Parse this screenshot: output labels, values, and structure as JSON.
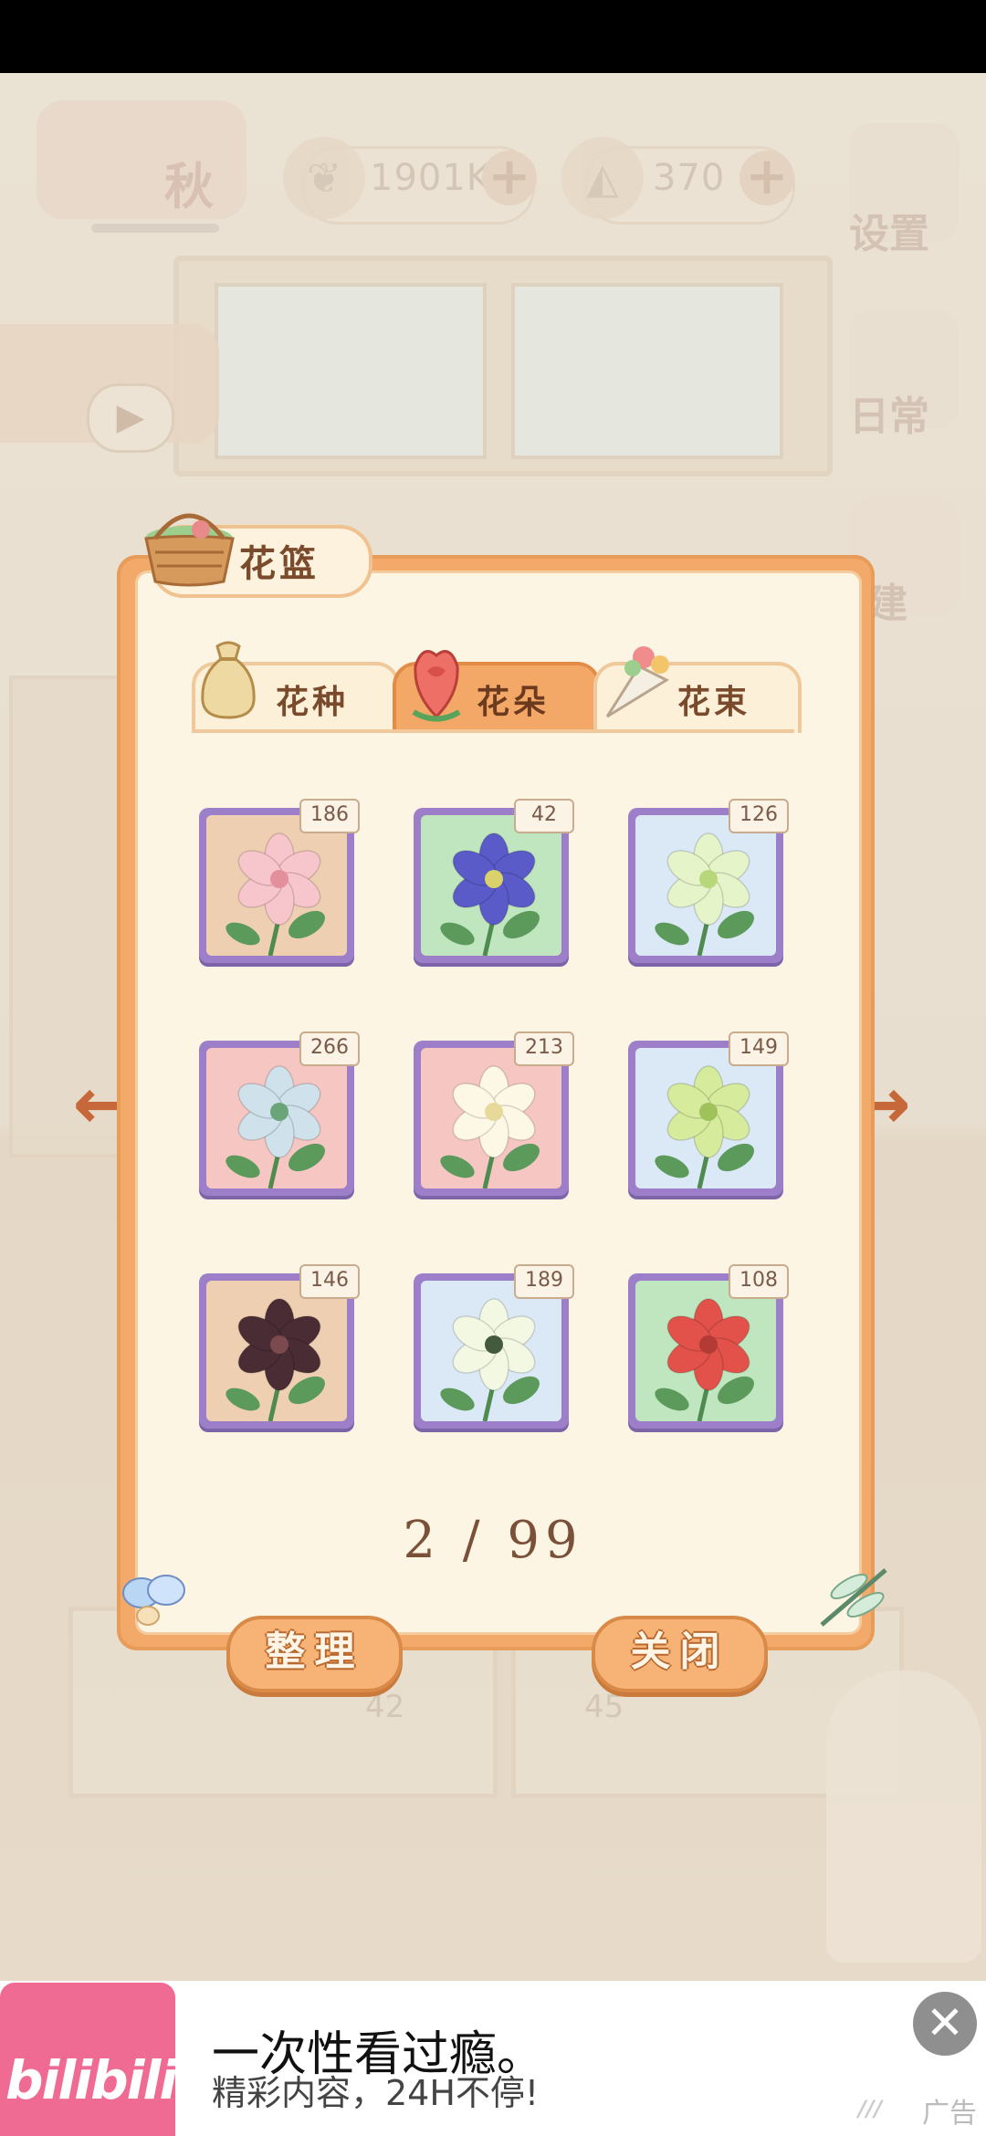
{
  "hud": {
    "season": "秋",
    "currency_fish": "1901K",
    "currency_cheese": "370",
    "plus": "+",
    "side_buttons": [
      "设置",
      "日常",
      "建"
    ],
    "video_play": "▶"
  },
  "floor_numbers": [
    "42",
    "45"
  ],
  "panel": {
    "title": "花篮",
    "tabs": [
      {
        "label": "花种",
        "active": false
      },
      {
        "label": "花朵",
        "active": true
      },
      {
        "label": "花束",
        "active": false
      }
    ],
    "items": [
      {
        "count": "186",
        "bg": "#efcfb1",
        "flower": "#f7c5cc",
        "center": "#e38f9c"
      },
      {
        "count": "42",
        "bg": "#bfe6bf",
        "flower": "#5a5ac9",
        "center": "#d9d26a"
      },
      {
        "count": "126",
        "bg": "#dbe9f6",
        "flower": "#e6f4c9",
        "center": "#b8d77b"
      },
      {
        "count": "266",
        "bg": "#f6c6c2",
        "flower": "#cfe1ea",
        "center": "#6aa57a"
      },
      {
        "count": "213",
        "bg": "#f6c6c2",
        "flower": "#fdf8e6",
        "center": "#e6d99a"
      },
      {
        "count": "149",
        "bg": "#dbe9f6",
        "flower": "#d6ec9c",
        "center": "#9fc25a"
      },
      {
        "count": "146",
        "bg": "#efcfb1",
        "flower": "#4a2c34",
        "center": "#7b4a4e"
      },
      {
        "count": "189",
        "bg": "#dbe9f6",
        "flower": "#f3f8e3",
        "center": "#445a3c"
      },
      {
        "count": "108",
        "bg": "#bfe6bf",
        "flower": "#e2524a",
        "center": "#b33a35"
      }
    ],
    "page_indicator": "2 / 99",
    "organize_label": "整理",
    "close_label": "关闭",
    "prev_arrow": "←",
    "next_arrow": "→"
  },
  "ad": {
    "logo": "bilibili",
    "title": "一次性看过瘾。",
    "subtitle": "精彩内容，24H不停!",
    "close": "✕",
    "tag": "广告"
  },
  "colors": {
    "panel": "#f2a96a",
    "tab_active": "#f3a868",
    "cell_frame": "#9d7ec9",
    "ad_pink": "#f06b94"
  }
}
